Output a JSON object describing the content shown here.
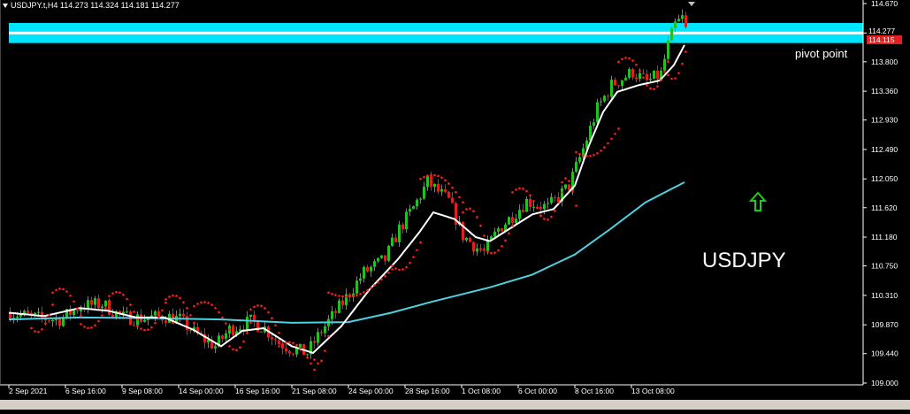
{
  "header": {
    "symbol_label": "USDJPY.t,H4  114.273 114.324 114.181 114.277"
  },
  "annotations": {
    "pivot_label": "pivot point",
    "symbol_text": "USDJPY"
  },
  "price_tags": {
    "current": "114.277",
    "pivot": "114.115"
  },
  "colors": {
    "background": "#000000",
    "bull": "#22c022",
    "bear": "#e02020",
    "fast_ma": "#ffffff",
    "slow_ma": "#4fd0e0",
    "sar": "#ff2020",
    "pivot_band": "#00e5ff",
    "arrow": "#18d018",
    "axis": "#ffffff"
  },
  "chart_data": {
    "type": "candlestick",
    "symbol": "USDJPY.t",
    "timeframe": "H4",
    "ohlc_readout": {
      "open": 114.273,
      "high": 114.324,
      "low": 114.181,
      "close": 114.277
    },
    "y_ticks": [
      114.67,
      114.23,
      113.8,
      113.36,
      112.93,
      112.49,
      112.05,
      111.62,
      111.18,
      110.75,
      110.31,
      109.87,
      109.44,
      109.0
    ],
    "ylim": [
      109.0,
      114.67
    ],
    "x_ticks": [
      "2 Sep 2021",
      "6 Sep 16:00",
      "9 Sep 08:00",
      "14 Sep 00:00",
      "16 Sep 16:00",
      "21 Sep 08:00",
      "24 Sep 00:00",
      "28 Sep 16:00",
      "1 Oct 08:00",
      "6 Oct 00:00",
      "8 Oct 16:00",
      "13 Oct 08:00"
    ],
    "x_tick_bars": [
      0,
      16,
      32,
      48,
      64,
      80,
      96,
      112,
      128,
      144,
      160,
      176
    ],
    "bar_count": 192,
    "close_path": [
      [
        0,
        110.05
      ],
      [
        8,
        109.97
      ],
      [
        14,
        109.95
      ],
      [
        20,
        110.15
      ],
      [
        26,
        110.18
      ],
      [
        32,
        109.98
      ],
      [
        38,
        109.97
      ],
      [
        44,
        110.0
      ],
      [
        48,
        109.95
      ],
      [
        52,
        109.75
      ],
      [
        58,
        109.55
      ],
      [
        62,
        109.8
      ],
      [
        68,
        109.92
      ],
      [
        72,
        109.82
      ],
      [
        76,
        109.6
      ],
      [
        80,
        109.5
      ],
      [
        84,
        109.45
      ],
      [
        88,
        109.78
      ],
      [
        94,
        110.2
      ],
      [
        100,
        110.65
      ],
      [
        106,
        110.85
      ],
      [
        110,
        111.3
      ],
      [
        114,
        111.62
      ],
      [
        118,
        112.0
      ],
      [
        124,
        111.72
      ],
      [
        128,
        111.2
      ],
      [
        132,
        111.02
      ],
      [
        134,
        110.95
      ],
      [
        138,
        111.3
      ],
      [
        142,
        111.5
      ],
      [
        146,
        111.72
      ],
      [
        152,
        111.62
      ],
      [
        158,
        111.95
      ],
      [
        162,
        112.5
      ],
      [
        166,
        113.1
      ],
      [
        170,
        113.45
      ],
      [
        176,
        113.65
      ],
      [
        180,
        113.5
      ],
      [
        184,
        113.62
      ],
      [
        186,
        114.05
      ],
      [
        188,
        114.35
      ],
      [
        190,
        114.45
      ],
      [
        191,
        114.28
      ]
    ],
    "fast_ma": [
      [
        0,
        110.05
      ],
      [
        10,
        110.0
      ],
      [
        20,
        110.12
      ],
      [
        28,
        110.08
      ],
      [
        36,
        109.98
      ],
      [
        44,
        109.98
      ],
      [
        52,
        109.8
      ],
      [
        60,
        109.55
      ],
      [
        66,
        109.78
      ],
      [
        72,
        109.82
      ],
      [
        80,
        109.55
      ],
      [
        86,
        109.45
      ],
      [
        94,
        109.85
      ],
      [
        102,
        110.4
      ],
      [
        110,
        110.85
      ],
      [
        116,
        111.25
      ],
      [
        120,
        111.55
      ],
      [
        126,
        111.45
      ],
      [
        132,
        111.18
      ],
      [
        136,
        111.12
      ],
      [
        142,
        111.32
      ],
      [
        148,
        111.52
      ],
      [
        154,
        111.6
      ],
      [
        160,
        111.95
      ],
      [
        164,
        112.55
      ],
      [
        168,
        113.05
      ],
      [
        172,
        113.35
      ],
      [
        178,
        113.45
      ],
      [
        184,
        113.52
      ],
      [
        188,
        113.75
      ],
      [
        191,
        114.05
      ]
    ],
    "slow_ma": [
      [
        0,
        109.95
      ],
      [
        20,
        109.98
      ],
      [
        40,
        109.97
      ],
      [
        60,
        109.95
      ],
      [
        80,
        109.9
      ],
      [
        96,
        109.91
      ],
      [
        108,
        110.05
      ],
      [
        120,
        110.22
      ],
      [
        136,
        110.43
      ],
      [
        148,
        110.62
      ],
      [
        160,
        110.92
      ],
      [
        170,
        111.3
      ],
      [
        180,
        111.7
      ],
      [
        191,
        112.0
      ]
    ],
    "sar_waves": [
      [
        6,
        12,
        109.82,
        "below"
      ],
      [
        12,
        20,
        110.35,
        "above"
      ],
      [
        20,
        28,
        109.88,
        "below"
      ],
      [
        28,
        36,
        110.3,
        "above"
      ],
      [
        36,
        44,
        109.85,
        "below"
      ],
      [
        44,
        52,
        110.25,
        "above"
      ],
      [
        52,
        62,
        110.15,
        "above"
      ],
      [
        62,
        68,
        109.55,
        "below"
      ],
      [
        68,
        76,
        110.1,
        "above"
      ],
      [
        76,
        86,
        109.55,
        "above"
      ],
      [
        86,
        90,
        109.35,
        "below"
      ],
      [
        90,
        108,
        110.35,
        "below"
      ],
      [
        108,
        116,
        110.75,
        "below"
      ],
      [
        116,
        128,
        112.05,
        "above"
      ],
      [
        128,
        134,
        111.55,
        "above"
      ],
      [
        134,
        142,
        111.0,
        "below"
      ],
      [
        142,
        150,
        111.85,
        "above"
      ],
      [
        150,
        156,
        111.5,
        "below"
      ],
      [
        156,
        160,
        112.0,
        "above"
      ],
      [
        160,
        172,
        112.45,
        "below"
      ],
      [
        172,
        180,
        113.8,
        "above"
      ],
      [
        180,
        186,
        113.45,
        "below"
      ],
      [
        186,
        191,
        113.6,
        "below"
      ]
    ],
    "pivot_band": {
      "upper": 114.38,
      "lower": 114.08
    },
    "current_price": 114.277,
    "pivot_price": 114.115
  }
}
